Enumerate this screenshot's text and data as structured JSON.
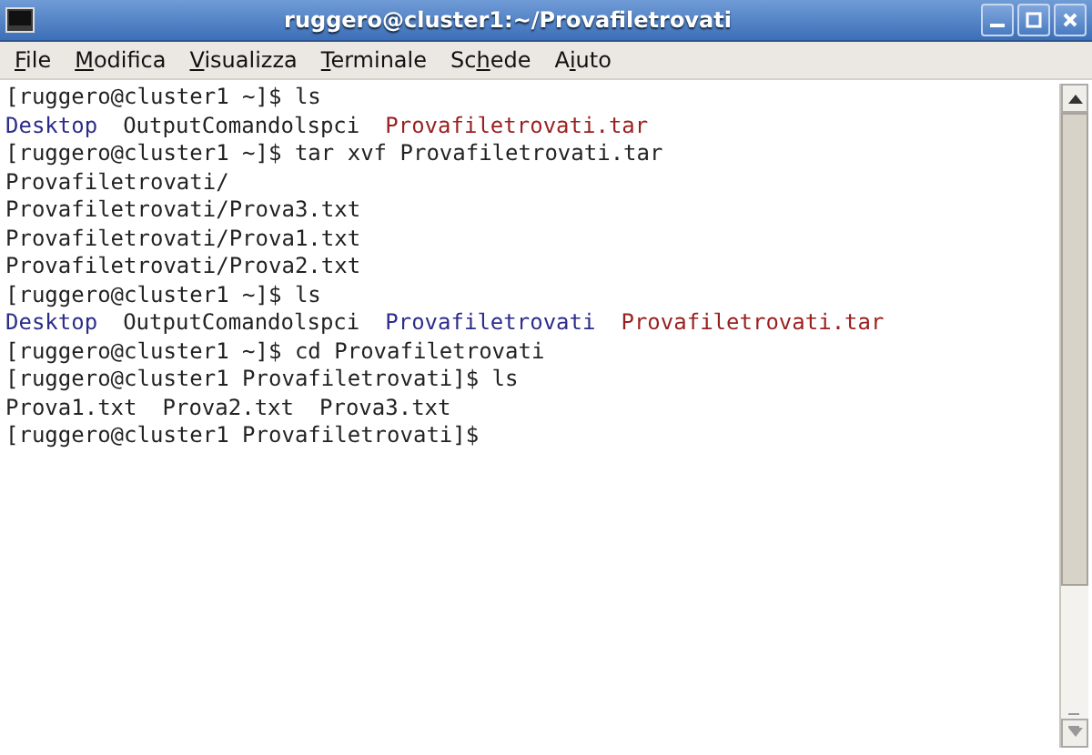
{
  "window": {
    "title": "ruggero@cluster1:~/Provafiletrovati"
  },
  "menu": [
    {
      "key": "F",
      "post": "ile"
    },
    {
      "key": "M",
      "post": "odifica"
    },
    {
      "key": "V",
      "post": "isualizza"
    },
    {
      "key": "T",
      "post": "erminale"
    },
    {
      "pre": "Sc",
      "key": "h",
      "post": "ede"
    },
    {
      "pre": "A",
      "key": "i",
      "post": "uto"
    }
  ],
  "terminal": {
    "lines": [
      [
        {
          "kind": "plain",
          "text": "[ruggero@cluster1 ~]$ ls"
        }
      ],
      [
        {
          "kind": "dir",
          "text": "Desktop"
        },
        {
          "kind": "plain",
          "text": "OutputComandolspci"
        },
        {
          "kind": "archive",
          "text": "Provafiletrovati.tar"
        }
      ],
      [
        {
          "kind": "plain",
          "text": "[ruggero@cluster1 ~]$ tar xvf Provafiletrovati.tar"
        }
      ],
      [
        {
          "kind": "plain",
          "text": "Provafiletrovati/"
        }
      ],
      [
        {
          "kind": "plain",
          "text": "Provafiletrovati/Prova3.txt"
        }
      ],
      [
        {
          "kind": "plain",
          "text": "Provafiletrovati/Prova1.txt"
        }
      ],
      [
        {
          "kind": "plain",
          "text": "Provafiletrovati/Prova2.txt"
        }
      ],
      [
        {
          "kind": "plain",
          "text": "[ruggero@cluster1 ~]$ ls"
        }
      ],
      [
        {
          "kind": "dir",
          "text": "Desktop"
        },
        {
          "kind": "plain",
          "text": "OutputComandolspci"
        },
        {
          "kind": "dir",
          "text": "Provafiletrovati"
        },
        {
          "kind": "archive",
          "text": "Provafiletrovati.tar"
        }
      ],
      [
        {
          "kind": "plain",
          "text": "[ruggero@cluster1 ~]$ cd Provafiletrovati"
        }
      ],
      [
        {
          "kind": "plain",
          "text": "[ruggero@cluster1 Provafiletrovati]$ ls"
        }
      ],
      [
        {
          "kind": "plain",
          "text": "Prova1.txt"
        },
        {
          "kind": "plain",
          "text": "Prova2.txt"
        },
        {
          "kind": "plain",
          "text": "Prova3.txt"
        }
      ],
      [
        {
          "kind": "plain",
          "text": "[ruggero@cluster1 Provafiletrovati]$"
        }
      ]
    ]
  }
}
